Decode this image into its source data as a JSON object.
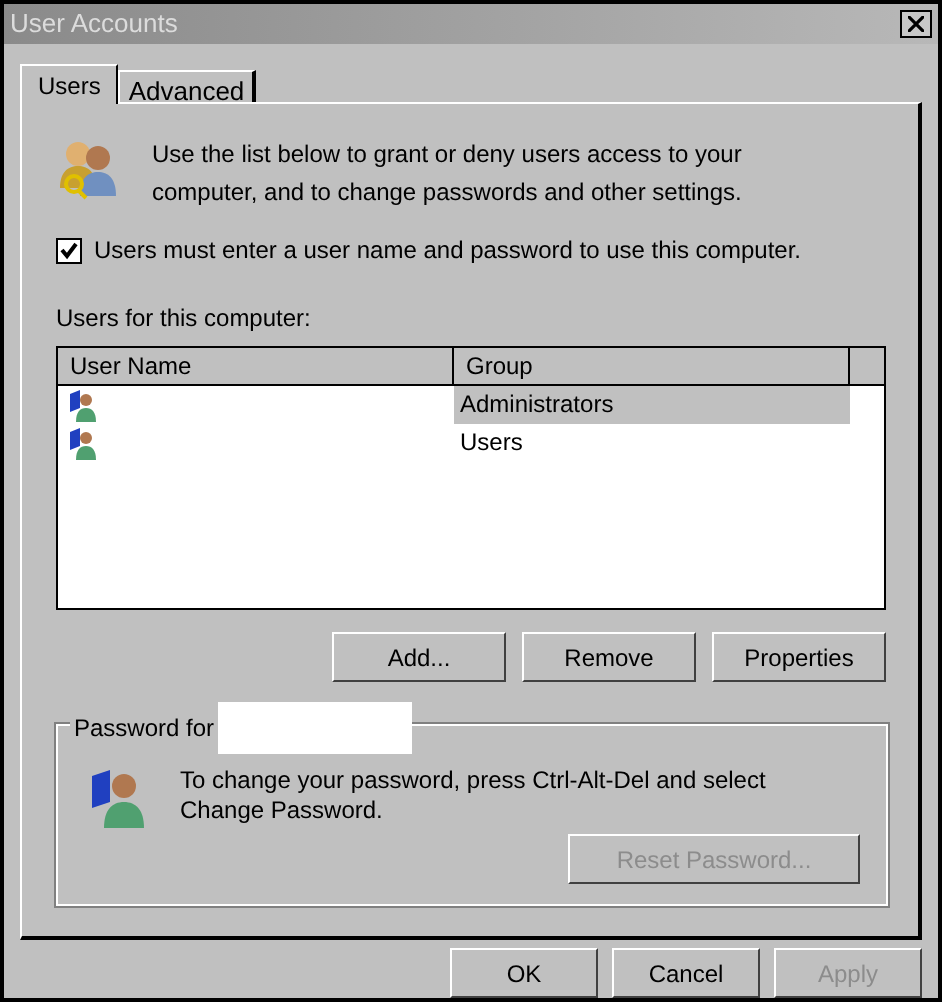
{
  "window": {
    "title": "User Accounts"
  },
  "tabs": [
    {
      "label": "Users",
      "selected": true
    },
    {
      "label": "Advanced",
      "selected": false
    }
  ],
  "intro": "Use the list below to grant or deny users access to your computer, and to change passwords and other settings.",
  "require_login": {
    "label": "Users must enter a user name and password to use this computer.",
    "checked": true
  },
  "users_list": {
    "label": "Users for this computer:",
    "columns": [
      "User Name",
      "Group"
    ],
    "rows": [
      {
        "group": "Administrators",
        "selected": true
      },
      {
        "group": "Users",
        "selected": false
      }
    ]
  },
  "list_buttons": [
    {
      "label": "Add...",
      "disabled": false
    },
    {
      "label": "Remove",
      "disabled": false
    },
    {
      "label": "Properties",
      "disabled": false
    }
  ],
  "password_group": {
    "legend": "Password for",
    "message": "To change your password, press Ctrl-Alt-Del and select Change Password.",
    "reset_button": {
      "label": "Reset Password...",
      "disabled": true
    }
  },
  "dialog_buttons": [
    {
      "label": "OK",
      "disabled": false
    },
    {
      "label": "Cancel",
      "disabled": false
    },
    {
      "label": "Apply",
      "disabled": true
    }
  ]
}
